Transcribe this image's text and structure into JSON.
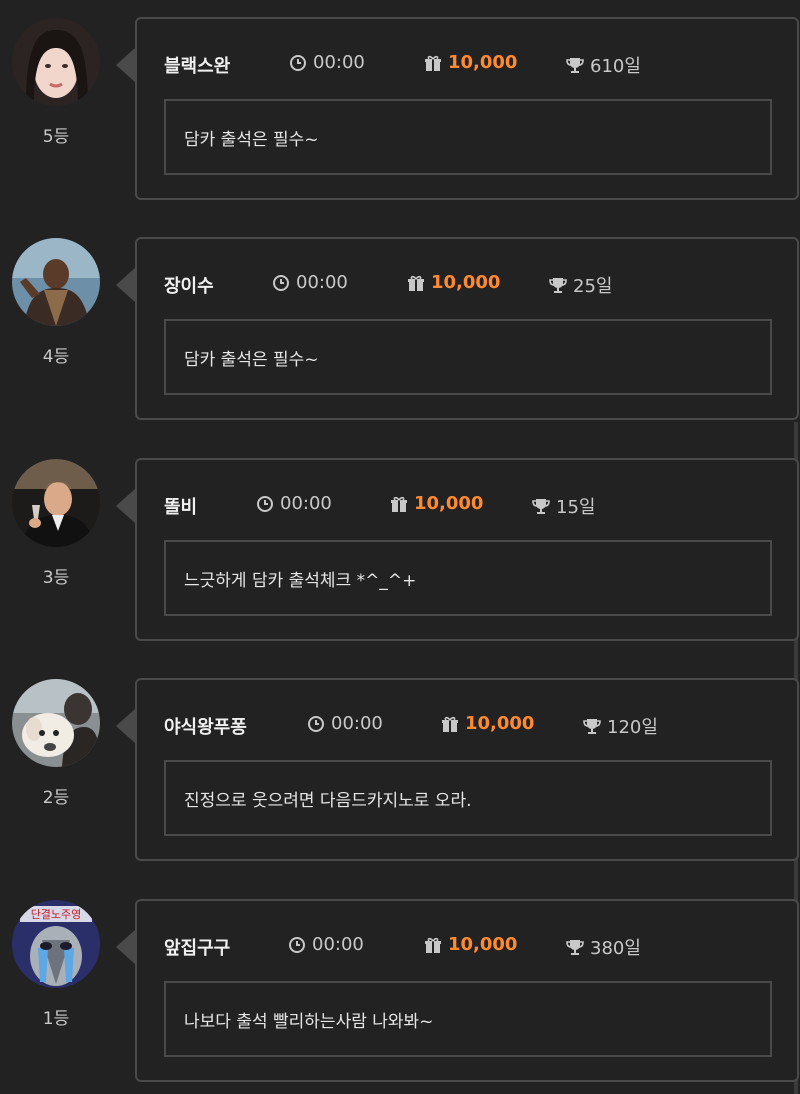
{
  "entries": [
    {
      "name": "블랙스완",
      "time": "00:00",
      "points": "10,000",
      "days": "610일",
      "message": "담카 출석은 필수~",
      "rank": "5등"
    },
    {
      "name": "장이수",
      "time": "00:00",
      "points": "10,000",
      "days": "25일",
      "message": "담카 출석은 필수~",
      "rank": "4등"
    },
    {
      "name": "똘비",
      "time": "00:00",
      "points": "10,000",
      "days": "15일",
      "message": "느긋하게 담카 출석체크 *^_^+",
      "rank": "3등"
    },
    {
      "name": "야식왕푸퐁",
      "time": "00:00",
      "points": "10,000",
      "days": "120일",
      "message": "진정으로 웃으려면 다음드카지노로 오라.",
      "rank": "2등"
    },
    {
      "name": "앞집구구",
      "time": "00:00",
      "points": "10,000",
      "days": "380일",
      "message": "나보다 출석 빨리하는사람 나와봐~",
      "rank": "1등"
    }
  ],
  "icons": {
    "time": "clock-icon",
    "points": "gift-icon",
    "days": "trophy-icon"
  },
  "colors": {
    "background": "#222222",
    "border": "#4a4a4a",
    "points": "#ff8a30"
  },
  "avatar_badge_text": "단결노주영"
}
